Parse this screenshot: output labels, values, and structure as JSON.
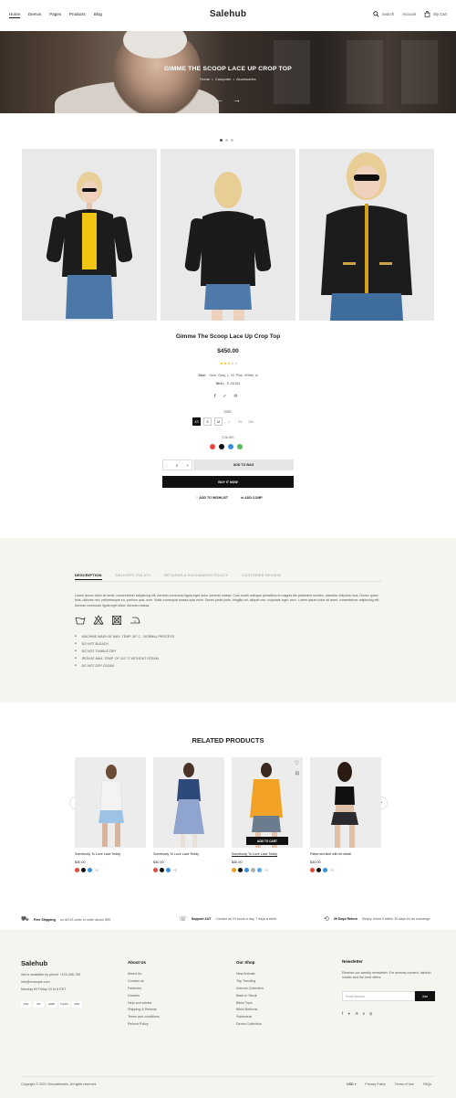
{
  "header": {
    "logo": "Salehub",
    "nav": [
      "Home",
      "Demos",
      "Pages",
      "Products",
      "Blog"
    ],
    "search_label": "Search",
    "account_label": "Account",
    "cart_label": "My Cart"
  },
  "hero": {
    "title": "GIMME THE SCOOP LACE UP CROP TOP",
    "breadcrumb": [
      "Home",
      "Computer",
      "Accessories"
    ],
    "prev_arrow": "←",
    "next_arrow": "→"
  },
  "product": {
    "title": "Gimme The Scoop Lace Up Crop Top",
    "price": "$450.00",
    "rating": 3,
    "size_line_label": "Size:",
    "size_line_value": "Xsm, Gray, L, M, Pink, White, sl",
    "sku_label": "SKU:",
    "sku_value": "E-00154",
    "size_label": "SIZE:",
    "sizes": [
      "XS",
      "S",
      "M",
      "L",
      "XL",
      "2XL"
    ],
    "selected_size": "XS",
    "color_label": "COLOR:",
    "colors": [
      "#e24a3b",
      "#111111",
      "#3c8fd8",
      "#5cb85c"
    ],
    "quantity": "2",
    "qty_minus": "-",
    "qty_plus": "+",
    "add_to_bag": "ADD TO BAG",
    "buy_now": "BUY IT NOW",
    "wishlist": "ADD TO WISHLIST",
    "compare": "ADD COMP"
  },
  "tabs": {
    "items": [
      "DESCRIPTION",
      "DELIVERY POLICY",
      "RETURNS & EXCHANGES POLICY",
      "CUSTOMER REVIEW"
    ],
    "active": "DESCRIPTION",
    "description": "Lorem ipsum dolor sit amet, consectetuer adipiscing elit. Aenean commodo ligula eget dolor. Aenean massa. Cum sociis natoque penatibus et magnis dis parturient montes, nascetur ridiculus mus. Donec quam felis, ultricies nec, pellentesque eu, pretium quis, sem. Nulla consequat massa quis enim. Donec pede justo, fringilla vel, aliquet nec, vulputate eget, arcu. Lorem ipsum dolor sit amet, consectetuer adipiscing elit. Aenean commodo ligula eget dolor. Aenean massa.",
    "care_list": [
      "MACHINE WASH AT MAX. TEMP. 30° C - NORMAL PROCESS",
      "DO NOT BLEACH",
      "DO NOT TUMBLE DRY",
      "IRON AT MAX. TEMP. OF 110 °C WITHOUT STEAM",
      "DO NOT DRY CLEAN"
    ]
  },
  "related": {
    "title": "RELATED PRODUCTS",
    "add_to_cart": "ADD TO CART",
    "products": [
      {
        "name": "Somebody To Love Lace Teddy",
        "price": "$30.00",
        "more": "+3",
        "swatches": [
          "#e24a3b",
          "#111111",
          "#3c8fd8"
        ]
      },
      {
        "name": "Somebody To Love Lace Teddy",
        "price": "$30.00",
        "more": "+3",
        "swatches": [
          "#e24a3b",
          "#111111",
          "#3c8fd8"
        ]
      },
      {
        "name": "Somebody To Love Lace Teddy",
        "price": "$30.00",
        "more": "+3",
        "swatches": [
          "#f0a22a",
          "#111111",
          "#3c8fd8",
          "#b0b0b0",
          "#5aa9e6"
        ]
      },
      {
        "name": "Patterned skirt with tie detail",
        "price": "$30.00",
        "more": "+3",
        "swatches": [
          "#e24a3b",
          "#111111",
          "#3c8fd8"
        ]
      }
    ]
  },
  "features": [
    {
      "title": "Free Shipping",
      "text": "on all US order or order above $99"
    },
    {
      "title": "Support 24/7",
      "text": "Contact us 24 hours a day, 7 days a week"
    },
    {
      "title": "30 Days Return",
      "text": "Simply return it within 30 days for an exchange"
    }
  ],
  "footer": {
    "logo": "Salehub",
    "contact": [
      "We're available by phone +123-456-789",
      "info@example.com",
      "Monday till Friday 10 to 6 EST"
    ],
    "payments": [
      "VISA",
      "MC",
      "AMEX",
      "PayPal",
      "DISC"
    ],
    "about_title": "About Us",
    "about_links": [
      "About Us",
      "Contact us",
      "Factories",
      "Careers",
      "Help and advice",
      "Shipping & Returns",
      "Terms and conditions",
      "Refund Policy"
    ],
    "shop_title": "Our Shop",
    "shop_links": [
      "New Arrivals",
      "Top Trending",
      "Autumn Collection",
      "Back In Stock",
      "Bikini Tops",
      "Bikini Bottoms",
      "Swimwear",
      "Denim Collection"
    ],
    "newsletter_title": "Newsletter",
    "newsletter_text": "Receive our weekly newsletter. For dreamy content, fashion insider and the best offers.",
    "newsletter_placeholder": "Email Address",
    "join": "Join",
    "copyright": "Copyright © 2021 Vinovathemes. All rights reserved.",
    "currency": "USD",
    "bottom_links": [
      "Privacy Policy",
      "Terms of Use",
      "FAQs"
    ]
  }
}
